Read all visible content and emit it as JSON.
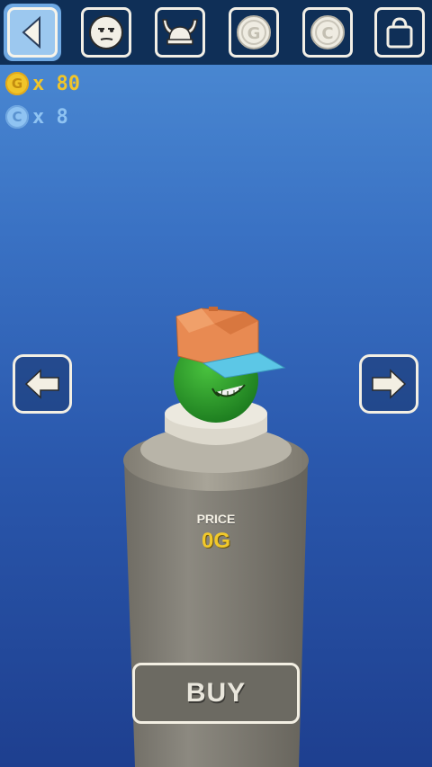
{
  "toolbar": {
    "tabs": [
      {
        "icon": "back-arrow-icon",
        "active": true
      },
      {
        "icon": "face-icon",
        "active": false
      },
      {
        "icon": "viking-helmet-icon",
        "active": false
      },
      {
        "icon": "gold-coin-icon",
        "glyph": "G",
        "active": false
      },
      {
        "icon": "crystal-coin-icon",
        "glyph": "C",
        "active": false
      },
      {
        "icon": "shopping-bag-icon",
        "active": false
      }
    ]
  },
  "currency": {
    "gold": {
      "glyph": "G",
      "text": "x 80",
      "color": "#f0c52a"
    },
    "crystal": {
      "glyph": "C",
      "text": "x 8",
      "color": "#8fc3f2"
    }
  },
  "shop": {
    "price_label": "PRICE",
    "price_value": "0G",
    "buy_label": "BUY",
    "prev_icon": "left-arrow-icon",
    "next_icon": "right-arrow-icon"
  },
  "item": {
    "name_icon": "baseball-cap-icon",
    "cap_color": "#e88a52",
    "visor_color": "#5cc7e6",
    "character_color": "#2f9a2f"
  }
}
